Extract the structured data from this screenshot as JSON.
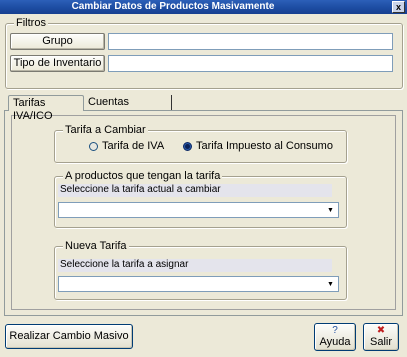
{
  "window": {
    "title": "Cambiar Datos de Productos Masivamente",
    "close_glyph": "x"
  },
  "filtros": {
    "legend": "Filtros",
    "grupo_button": "Grupo",
    "grupo_value": "",
    "tipo_button": "Tipo de Inventario",
    "tipo_value": ""
  },
  "tabs": [
    {
      "label": "Tarifas IVA/ICO",
      "active": true
    },
    {
      "label": "Cuentas Contables",
      "active": false
    }
  ],
  "tarifa_cambiar": {
    "legend": "Tarifa a Cambiar",
    "option_iva": "Tarifa de IVA",
    "option_consumo": "Tarifa Impuesto al Consumo",
    "selected": "Tarifa Impuesto al Consumo"
  },
  "productos": {
    "legend": "A productos que tengan la tarifa",
    "label": "Seleccione la tarifa actual a cambiar",
    "value": ""
  },
  "nueva_tarifa": {
    "legend": "Nueva Tarifa",
    "label": "Seleccione la tarifa a asignar",
    "value": ""
  },
  "footer": {
    "realizar_button": "Realizar Cambio Masivo",
    "ayuda_button": "Ayuda",
    "ayuda_icon": "help-icon",
    "salir_button": "Salir",
    "salir_icon": "exit-icon"
  },
  "colors": {
    "titlebar": "#1e4ea4",
    "window_bg": "#ece9d8",
    "field_border": "#7f9db9"
  }
}
